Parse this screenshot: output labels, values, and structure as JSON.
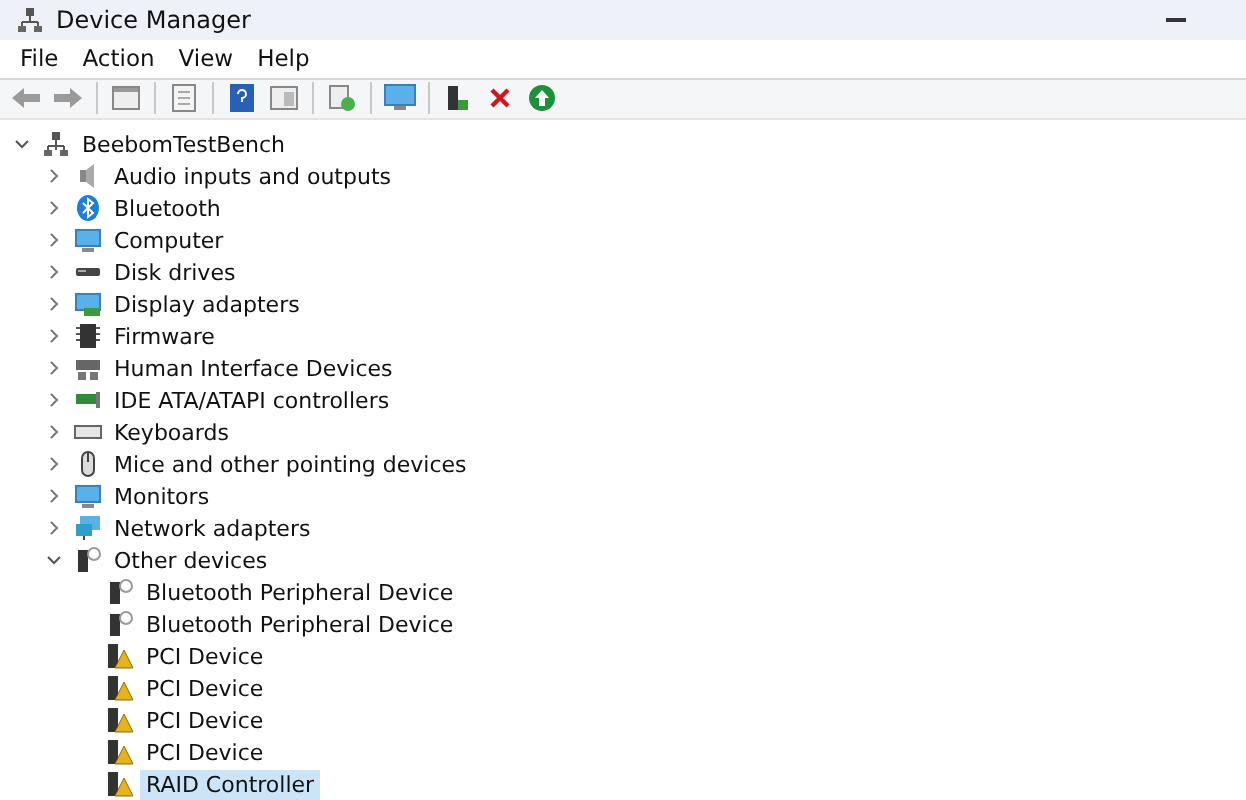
{
  "window": {
    "title": "Device Manager"
  },
  "menu": [
    "File",
    "Action",
    "View",
    "Help"
  ],
  "tree": {
    "label": "BeebomTestBench",
    "kind": "pc",
    "expanded": true,
    "selected": false,
    "children": [
      {
        "label": "Audio inputs and outputs",
        "kind": "audio",
        "expanded": false,
        "selected": false
      },
      {
        "label": "Bluetooth",
        "kind": "bluetooth",
        "expanded": false,
        "selected": false
      },
      {
        "label": "Computer",
        "kind": "computer",
        "expanded": false,
        "selected": false
      },
      {
        "label": "Disk drives",
        "kind": "disk",
        "expanded": false,
        "selected": false
      },
      {
        "label": "Display adapters",
        "kind": "display",
        "expanded": false,
        "selected": false
      },
      {
        "label": "Firmware",
        "kind": "firmware",
        "expanded": false,
        "selected": false
      },
      {
        "label": "Human Interface Devices",
        "kind": "hid",
        "expanded": false,
        "selected": false
      },
      {
        "label": "IDE ATA/ATAPI controllers",
        "kind": "ide",
        "expanded": false,
        "selected": false
      },
      {
        "label": "Keyboards",
        "kind": "keyboard",
        "expanded": false,
        "selected": false
      },
      {
        "label": "Mice and other pointing devices",
        "kind": "mouse",
        "expanded": false,
        "selected": false
      },
      {
        "label": "Monitors",
        "kind": "computer",
        "expanded": false,
        "selected": false
      },
      {
        "label": "Network adapters",
        "kind": "network",
        "expanded": false,
        "selected": false
      },
      {
        "label": "Other devices",
        "kind": "unknown",
        "expanded": true,
        "selected": false,
        "children": [
          {
            "label": "Bluetooth Peripheral Device",
            "kind": "unknown",
            "selected": false
          },
          {
            "label": "Bluetooth Peripheral Device",
            "kind": "unknown",
            "selected": false
          },
          {
            "label": "PCI Device",
            "kind": "warning",
            "selected": false
          },
          {
            "label": "PCI Device",
            "kind": "warning",
            "selected": false
          },
          {
            "label": "PCI Device",
            "kind": "warning",
            "selected": false
          },
          {
            "label": "PCI Device",
            "kind": "warning",
            "selected": false
          },
          {
            "label": "RAID Controller",
            "kind": "warning",
            "selected": true
          }
        ]
      }
    ]
  }
}
